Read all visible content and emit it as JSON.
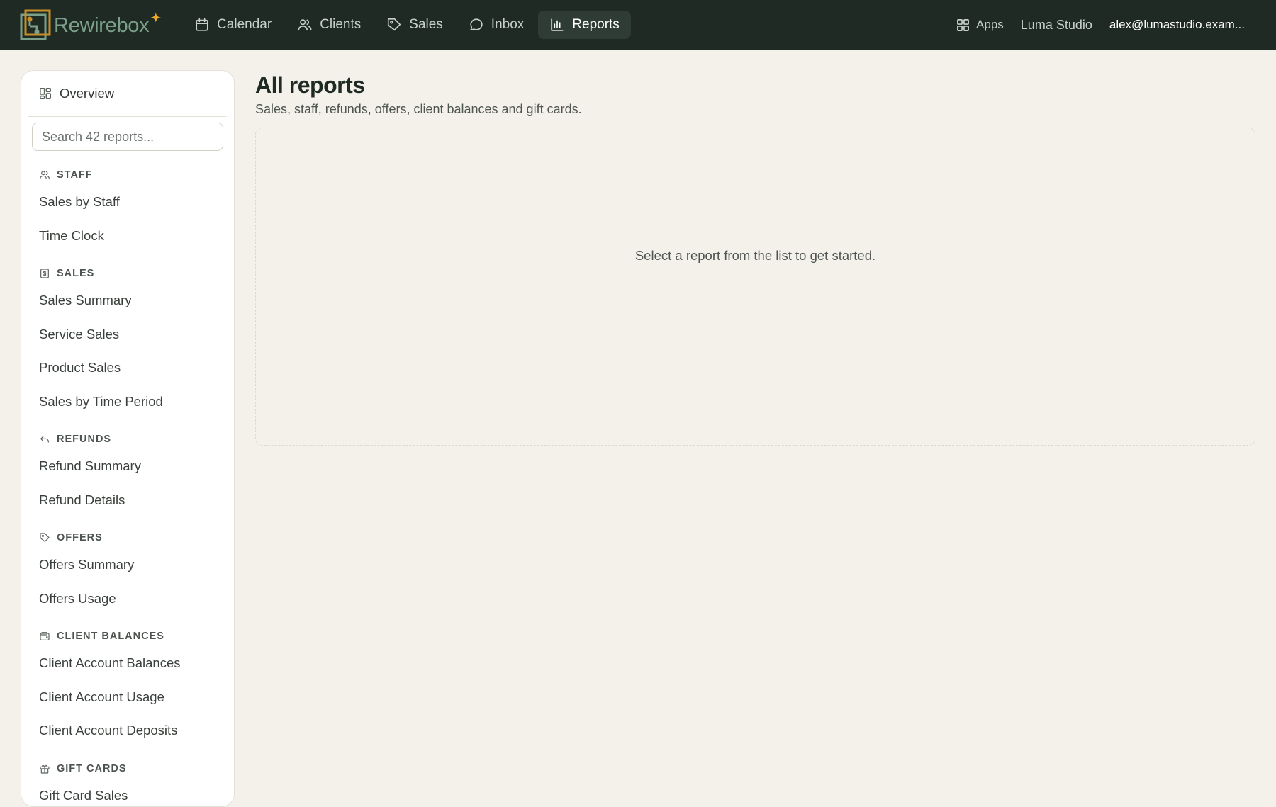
{
  "brand": {
    "name": "Rewirebox",
    "accent_color": "#e8a62a",
    "logo_color": "#7aa08a"
  },
  "nav": {
    "items": [
      {
        "label": "Calendar",
        "icon": "calendar-icon"
      },
      {
        "label": "Clients",
        "icon": "users-icon"
      },
      {
        "label": "Sales",
        "icon": "tag-icon"
      },
      {
        "label": "Inbox",
        "icon": "chat-icon"
      },
      {
        "label": "Reports",
        "icon": "bar-chart-icon",
        "active": true
      }
    ],
    "apps_label": "Apps",
    "studio_label": "Luma Studio",
    "user_email": "alex@lumastudio.exam..."
  },
  "sidebar": {
    "overview_label": "Overview",
    "search_placeholder": "Search 42 reports...",
    "groups": [
      {
        "title": "STAFF",
        "icon": "users-icon",
        "items": [
          "Sales by Staff",
          "Time Clock"
        ]
      },
      {
        "title": "SALES",
        "icon": "receipt-icon",
        "items": [
          "Sales Summary",
          "Service Sales",
          "Product Sales",
          "Sales by Time Period"
        ]
      },
      {
        "title": "REFUNDS",
        "icon": "undo-icon",
        "items": [
          "Refund Summary",
          "Refund Details"
        ]
      },
      {
        "title": "OFFERS",
        "icon": "tag-icon",
        "items": [
          "Offers Summary",
          "Offers Usage"
        ]
      },
      {
        "title": "CLIENT BALANCES",
        "icon": "wallet-icon",
        "items": [
          "Client Account Balances",
          "Client Account Usage",
          "Client Account Deposits"
        ]
      },
      {
        "title": "GIFT CARDS",
        "icon": "gift-icon",
        "items": [
          "Gift Card Sales"
        ]
      }
    ]
  },
  "main": {
    "title": "All reports",
    "subtitle": "Sales, staff, refunds, offers, client balances and gift cards.",
    "empty_message": "Select a report from the list to get started."
  }
}
